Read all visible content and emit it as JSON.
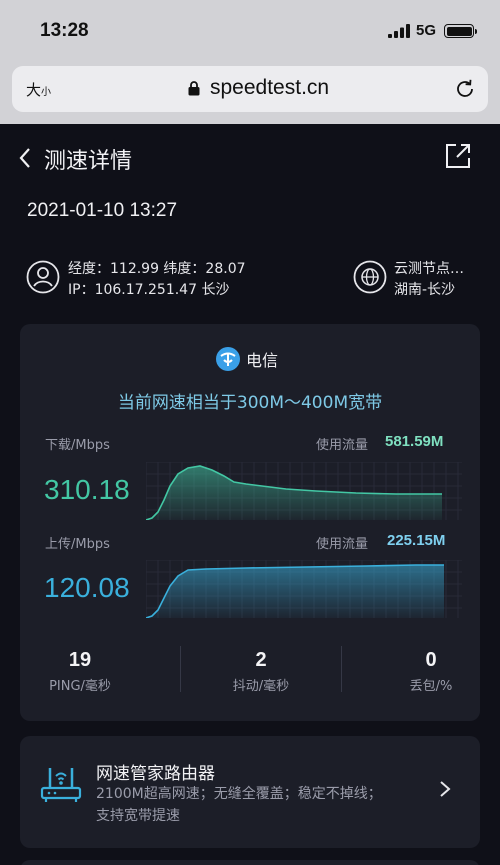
{
  "status_bar": {
    "time": "13:28",
    "network": "5G"
  },
  "browser": {
    "text_size_big": "大",
    "text_size_small": "小",
    "url": "speedtest.cn"
  },
  "header": {
    "title": "测速详情"
  },
  "test_time": "2021-01-10 13:27",
  "location": {
    "line1": "经度：112.99  纬度：28.07",
    "line2": "IP：106.17.251.47  长沙"
  },
  "node": {
    "line1": "云测节点…",
    "line2": "湖南-长沙"
  },
  "result": {
    "isp": "电信",
    "equivalent": "当前网速相当于300M～400M宽带",
    "download": {
      "label": "下载/Mbps",
      "value": "310.18",
      "usage_label": "使用流量",
      "usage_value": "581.59M",
      "color": "#43c7a4"
    },
    "upload": {
      "label": "上传/Mbps",
      "value": "120.08",
      "usage_label": "使用流量",
      "usage_value": "225.15M",
      "color": "#3ab0dc"
    },
    "stats": [
      {
        "value": "19",
        "label": "PING/毫秒"
      },
      {
        "value": "2",
        "label": "抖动/毫秒"
      },
      {
        "value": "0",
        "label": "丢包/%"
      }
    ]
  },
  "ad": {
    "title": "网速管家路由器",
    "desc_line1": "2100M超高网速；无缝全覆盖；稳定不掉线；",
    "desc_line2": "支持宽带提速"
  },
  "icons": {
    "back": "chevron-left-icon",
    "share": "share-icon",
    "user": "user-icon",
    "globe": "globe-icon",
    "isp": "china-telecom-icon",
    "router": "router-icon",
    "ad_arrow": "chevron-right-icon",
    "lock": "lock-icon",
    "reload": "reload-icon"
  }
}
